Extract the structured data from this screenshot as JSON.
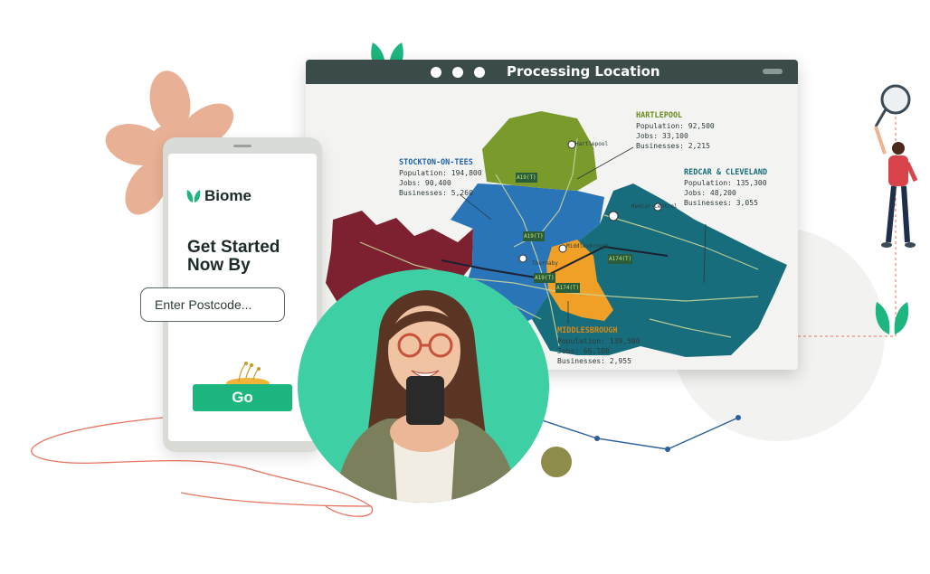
{
  "window": {
    "title": "Processing Location"
  },
  "map": {
    "regions": [
      {
        "name": "HARTLEPOOL",
        "population": "Population: 92,500",
        "jobs": "Jobs: 33,100",
        "businesses": "Businesses: 2,215"
      },
      {
        "name": "STOCKTON-ON-TEES",
        "population": "Population: 194,800",
        "jobs": "Jobs: 90,400",
        "businesses": "Businesses: 5,260"
      },
      {
        "name": "REDCAR & CLEVELAND",
        "population": "Population: 135,300",
        "jobs": "Jobs: 48,200",
        "businesses": "Businesses: 3,055"
      },
      {
        "name": "MIDDLESBROUGH",
        "population": "Population: 139,500",
        "jobs": "Jobs: 66,100",
        "businesses": "Businesses: 2,955"
      }
    ],
    "town_labels": [
      "Hartlepool",
      "Redcar Central",
      "Middlesbrough",
      "Thornaby"
    ],
    "road_labels": [
      "A19(T)",
      "A19(T)",
      "A174(T)",
      "A19(T)",
      "A174(T)"
    ],
    "colors": {
      "hartlepool": "#7a9a2c",
      "stockton": "#2a74b8",
      "redcar": "#176d7c",
      "middlesbrough": "#f0a026",
      "darlington": "#7d2130"
    }
  },
  "phone": {
    "brand": "Biome",
    "headline_line1": "Get Started",
    "headline_line2": "Now By",
    "postcode_placeholder": "Enter Postcode...",
    "go_label": "Go"
  },
  "colors": {
    "accent_green": "#1cb67e",
    "leaf_green": "#1cb67e",
    "window_bar": "#3b4b4a",
    "flower": "#e8b196",
    "circle": "#3ecfa4",
    "line_red": "#e8735e",
    "line_blue": "#2a5e9c",
    "olive_dot": "#8d8c4a"
  }
}
